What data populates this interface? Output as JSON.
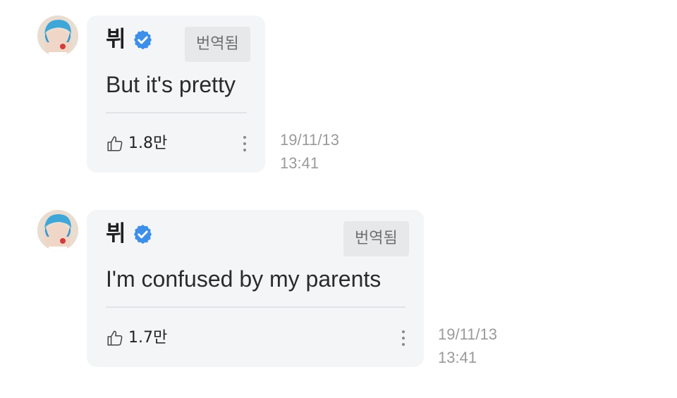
{
  "colors": {
    "bubble_bg": "#f3f5f7",
    "verified_blue": "#3d8fe8",
    "timestamp_gray": "#9a9a9a",
    "translated_bg": "#e6e8ea"
  },
  "messages": [
    {
      "author": "뷔",
      "verified_icon": "verified-badge-icon",
      "translated_label": "번역됨",
      "text": "But it's pretty",
      "like_icon": "thumbs-up-icon",
      "likes": "1.8만",
      "more_icon": "more-vertical-icon",
      "date": "19/11/13",
      "time": "13:41"
    },
    {
      "author": "뷔",
      "verified_icon": "verified-badge-icon",
      "translated_label": "번역됨",
      "text": "I'm confused by my parents",
      "like_icon": "thumbs-up-icon",
      "likes": "1.7만",
      "more_icon": "more-vertical-icon",
      "date": "19/11/13",
      "time": "13:41"
    }
  ]
}
